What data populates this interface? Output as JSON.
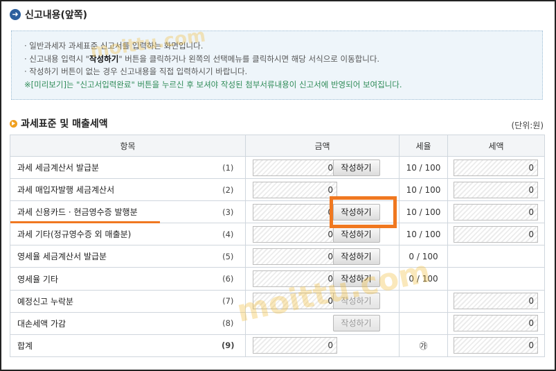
{
  "header": {
    "title": "신고내용(앞쪽)"
  },
  "notice": {
    "line1": "· 일반과세자 과세표준 신고서를 입력하는 화면입니다.",
    "line2_pre": "· 신고내용 입력시 \"",
    "line2_hl": "작성하기",
    "line2_post": "\" 버튼을 클릭하거나 왼쪽의 선택메뉴를 클릭하시면 해당 서식으로 이동합니다.",
    "line3": "· 작성하기 버튼이 없는 경우 신고내용을 직접 입력하시기 바랍니다.",
    "line4": "※[미리보기]는 \"신고서입력완료\" 버튼을 누르신 후 보셔야 작성된 첨부서류내용이 신고서에 반영되어 보여집니다."
  },
  "section": {
    "title": "과세표준 및 매출세액",
    "unit": "(단위:원)"
  },
  "table": {
    "headers": {
      "item": "항목",
      "amount": "금액",
      "rate": "세율",
      "tax": "세액"
    },
    "rows": [
      {
        "label": "과세 세금계산서 발급분",
        "num": "(1)",
        "amount": "0",
        "button": "작성하기",
        "rate": "10 / 100",
        "tax": "0"
      },
      {
        "label": "과세 매입자발행 세금계산서",
        "num": "(2)",
        "amount": "0",
        "button": "",
        "rate": "10 / 100",
        "tax": "0"
      },
      {
        "label": "과세 신용카드 · 현금영수증 발행분",
        "num": "(3)",
        "amount": "0",
        "button": "작성하기",
        "rate": "10 / 100",
        "tax": "0"
      },
      {
        "label": "과세 기타(정규영수증 외 매출분)",
        "num": "(4)",
        "amount": "0",
        "button": "작성하기",
        "rate": "10 / 100",
        "tax": "0"
      },
      {
        "label": "영세율 세금계산서 발급분",
        "num": "(5)",
        "amount": "0",
        "button": "작성하기",
        "rate": "0 / 100",
        "tax": ""
      },
      {
        "label": "영세율 기타",
        "num": "(6)",
        "amount": "0",
        "button": "작성하기",
        "rate": "0 / 100",
        "tax": ""
      },
      {
        "label": "예정신고 누락분",
        "num": "(7)",
        "amount": "0",
        "button": "작성하기",
        "rate": "",
        "tax": "0"
      },
      {
        "label": "대손세액 가감",
        "num": "(8)",
        "amount": "",
        "button": "작성하기",
        "rate": "",
        "tax": "0"
      },
      {
        "label": "합계",
        "num": "(9)",
        "amount": "0",
        "button": "",
        "rate": "㉮",
        "tax": "0"
      }
    ]
  },
  "watermark": {
    "text": "moittu.com"
  },
  "colors": {
    "accent": "#f07820",
    "title_bullet": "#2b5f9e",
    "notice_bg": "#eef5fa"
  }
}
